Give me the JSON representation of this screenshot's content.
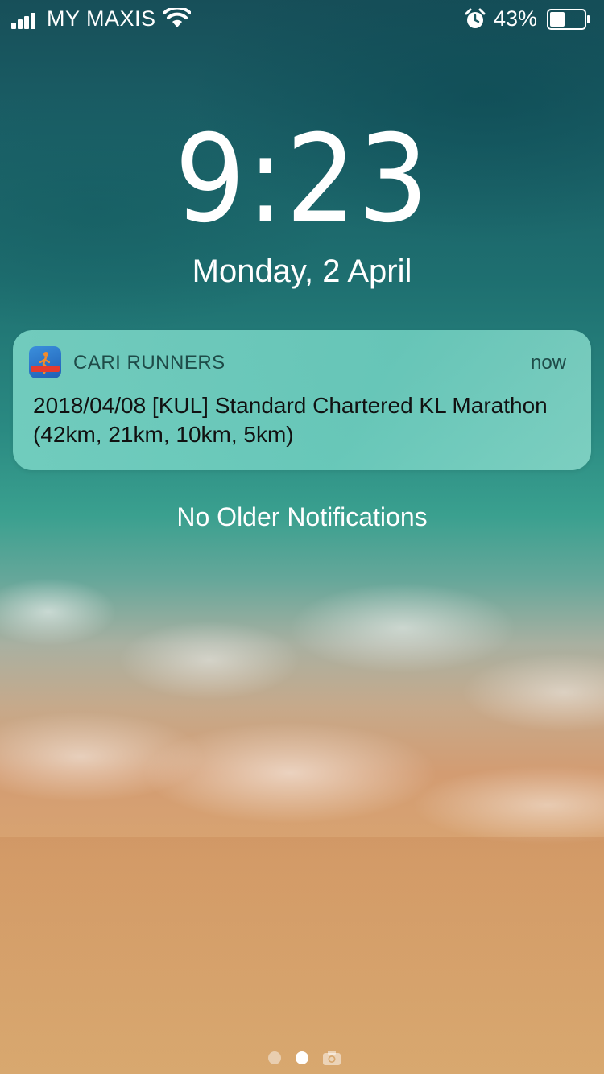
{
  "status_bar": {
    "carrier": "MY MAXIS",
    "battery_percent": "43%",
    "battery_level": 0.43,
    "signal_bars": 4,
    "icons": [
      "signal-icon",
      "wifi-icon",
      "alarm-icon",
      "battery-icon"
    ]
  },
  "lock_screen": {
    "time": "9:23",
    "date": "Monday, 2 April"
  },
  "notification": {
    "app_name": "CARI RUNNERS",
    "time": "now",
    "body": "2018/04/08 [KUL] Standard Chartered KL Marathon (42km, 21km, 10km, 5km)",
    "icon": "cari-runners-app-icon"
  },
  "footer_text": "No Older Notifications",
  "page_indicator": {
    "pages": 2,
    "current": 2,
    "trailing_icon": "camera-icon"
  },
  "colors": {
    "notification_bg": "#78d2c3",
    "notification_header_text": "#1e4b48",
    "text_primary": "#ffffff"
  }
}
